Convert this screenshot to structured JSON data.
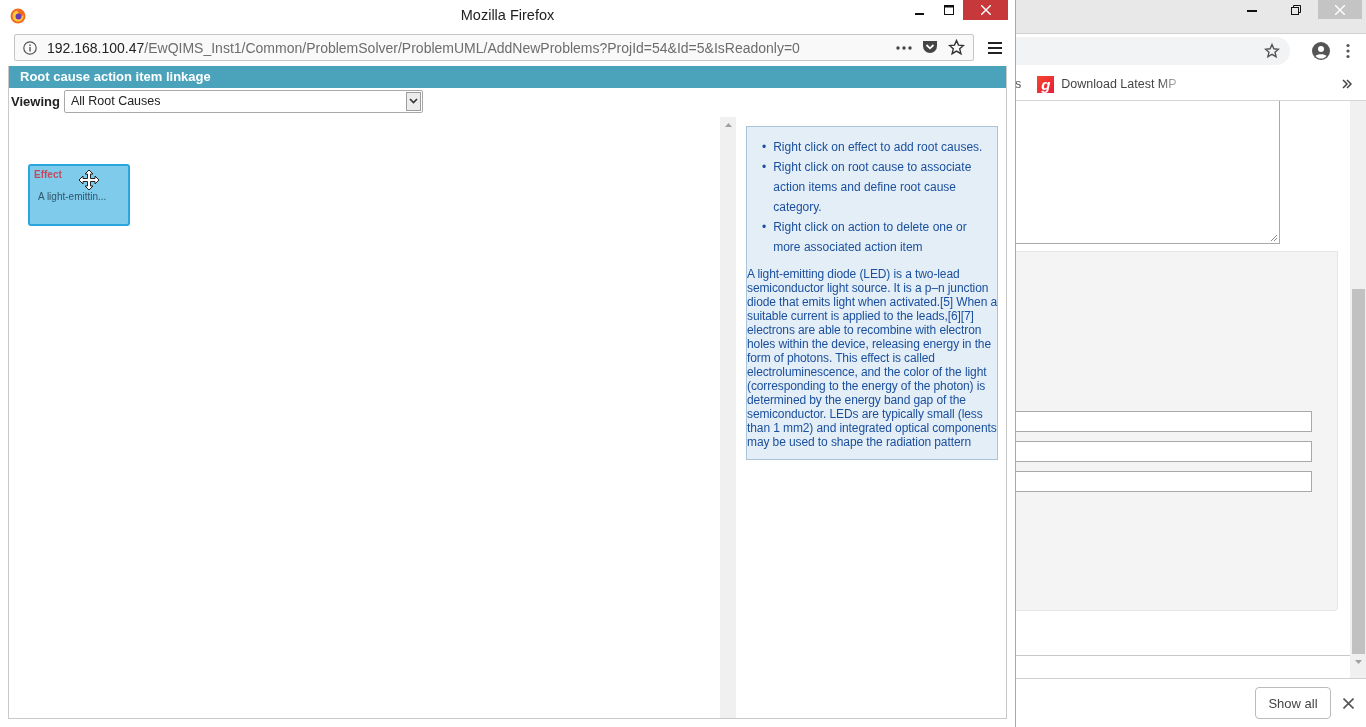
{
  "background_window": {
    "bookmarks": [
      {
        "kind": "partial",
        "label": "s"
      },
      {
        "kind": "site",
        "icon_glyph": "g",
        "label": "Download Latest MP"
      }
    ],
    "download_bar": {
      "button": "Show all"
    }
  },
  "browser_window": {
    "title": "Mozilla Firefox",
    "url_host": "192.168.100.47",
    "url_path": "/EwQIMS_Inst1/Common/ProblemSolver/ProblemUML/AddNewProblems?ProjId=54&Id=5&IsReadonly=0"
  },
  "page": {
    "header": "Root cause action item linkage",
    "viewing_label": "Viewing",
    "viewing_select": "All Root Causes",
    "nodes": [
      {
        "kind": "effect",
        "type_label": "Effect",
        "text": "A light-emittin..."
      }
    ],
    "help": {
      "tips": [
        {
          "bullet": "•",
          "text": "Right click on effect to add root causes."
        },
        {
          "bullet": "•",
          "text": "Right click on root cause to associate action items and define root cause category."
        },
        {
          "bullet": "•",
          "text": "Right click on action to delete one or more associated action item"
        }
      ],
      "description": "A light-emitting diode (LED) is a two-lead semiconductor light source. It is a p–n junction diode that emits light when activated.[5] When a suitable current is applied to the leads,[6][7] electrons are able to recombine with electron holes within the device, releasing energy in the form of photons. This effect is called electroluminescence, and the color of the light (corresponding to the energy of the photon) is determined by the energy band gap of the semiconductor. LEDs are typically small (less than 1 mm2) and integrated optical components may be used to shape the radiation pattern"
    }
  }
}
